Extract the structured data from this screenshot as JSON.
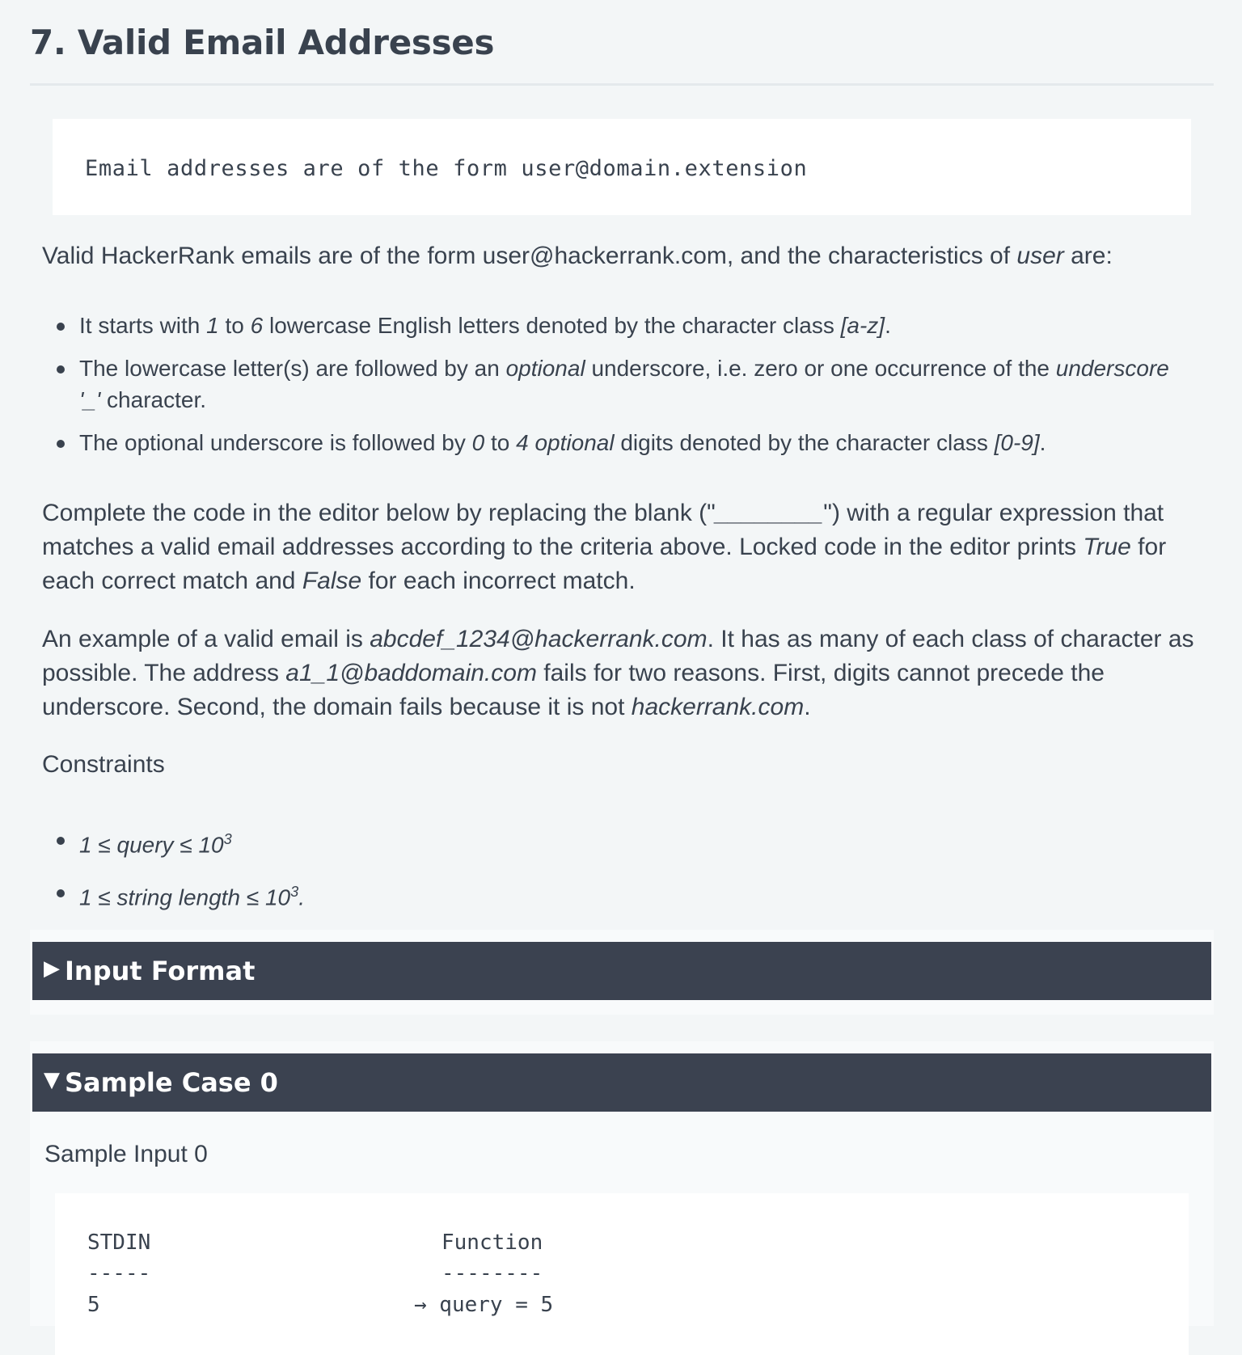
{
  "title": "7. Valid Email Addresses",
  "code_line": "Email addresses are of the form user@domain.extension",
  "intro": {
    "text1": "Valid HackerRank emails are of the form user@hackerrank.com, and the characteristics of ",
    "em1": "user",
    "text2": " are:"
  },
  "rules": [
    {
      "t1": "It starts with ",
      "e1": "1",
      "t2": " to ",
      "e2": "6",
      "t3": " lowercase English letters denoted by the character class ",
      "e3": "[a-z]",
      "t4": "."
    },
    {
      "t1": "The lowercase letter(s) are followed by an ",
      "e1": "optional",
      "t2": " underscore, i.e. zero or one occurrence of the ",
      "e2": "underscore '_'",
      "t3": " character."
    },
    {
      "t1": "The optional underscore is followed by ",
      "e1": "0",
      "t2": " to ",
      "e2": "4 optional",
      "t3": " digits denoted by the character class ",
      "e3": "[0-9]",
      "t4": "."
    }
  ],
  "complete": {
    "t1": "Complete the code in the editor below by replacing the blank (\"",
    "blank": "________",
    "t2": "\") with a regular expression that matches a valid email addresses according to the criteria above. Locked code in the editor prints ",
    "e1": "True",
    "t3": " for each correct match and ",
    "e2": "False",
    "t4": " for each incorrect match."
  },
  "example": {
    "t1": "An example of a valid email is ",
    "e1": "abcdef_1234@hackerrank.com",
    "t2": ".  It has as many of each class of character as possible.  The address ",
    "e2": "a1_1@baddomain.com",
    "t3": " fails for two reasons.  First, digits cannot precede the underscore.  Second, the domain fails because it is not ",
    "e3": "hackerrank.com",
    "t4": "."
  },
  "constraints_heading": "Constraints",
  "constraints": [
    {
      "text": "1 ≤ query ≤ 10",
      "sup": "3",
      "tail": ""
    },
    {
      "text": "1 ≤ string length ≤ 10",
      "sup": "3",
      "tail": "."
    }
  ],
  "input_format": {
    "arrow": "▶",
    "label": "Input Format"
  },
  "sample_case": {
    "arrow": "▼",
    "label": "Sample Case 0"
  },
  "sample_input_heading": "Sample Input 0",
  "sample_table": {
    "col1_header": "STDIN",
    "col2_header": "Function",
    "col1_rule": "-----",
    "col2_rule": "--------",
    "row1_stdin": "5",
    "row1_fn": "→ query = 5"
  }
}
